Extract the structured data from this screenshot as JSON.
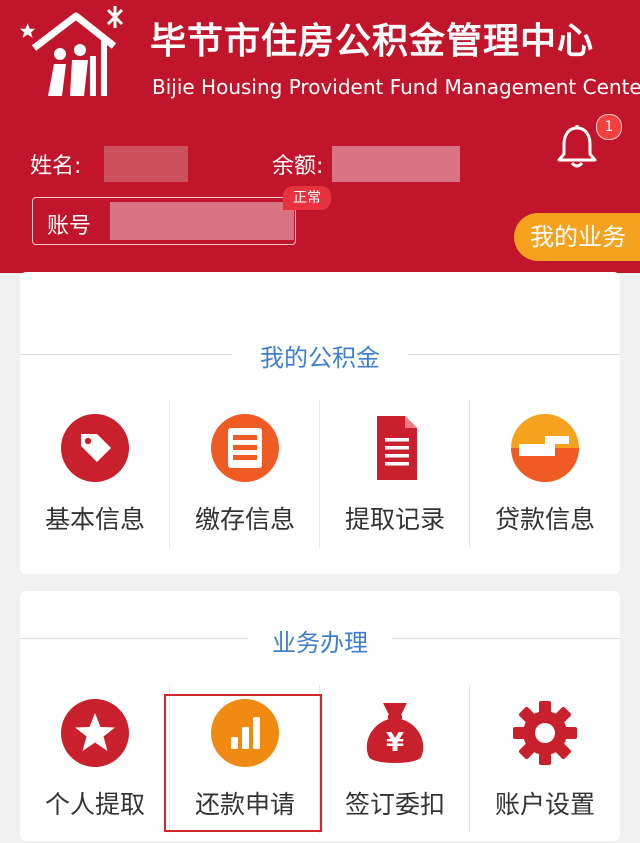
{
  "header": {
    "title_cn": "毕节市住房公积金管理中心",
    "title_en": "Bijie Housing Provident Fund Management Center",
    "notification_count": "1"
  },
  "account": {
    "name_label": "姓名:",
    "balance_label": "余额:",
    "account_label": "账号",
    "status": "正常"
  },
  "my_business_button": "我的业务",
  "section_fund": {
    "title": "我的公积金",
    "items": [
      {
        "label": "基本信息",
        "icon": "tag-icon",
        "color": "#c8202c"
      },
      {
        "label": "缴存信息",
        "icon": "document-list-icon",
        "color": "#f05a24"
      },
      {
        "label": "提取记录",
        "icon": "file-icon",
        "color": "#c8202c"
      },
      {
        "label": "贷款信息",
        "icon": "loan-icon",
        "color": "#f5a31f"
      }
    ]
  },
  "section_business": {
    "title": "业务办理",
    "items": [
      {
        "label": "个人提取",
        "icon": "star-icon",
        "color": "#c8202c"
      },
      {
        "label": "还款申请",
        "icon": "bar-chart-icon",
        "color": "#f08a12"
      },
      {
        "label": "签订委扣",
        "icon": "money-bag-icon",
        "color": "#c8202c"
      },
      {
        "label": "账户设置",
        "icon": "gear-icon",
        "color": "#c8202c"
      }
    ]
  },
  "colors": {
    "brand_red": "#c0152a",
    "accent_orange": "#f5a31f",
    "section_title_blue": "#3f7fce"
  }
}
